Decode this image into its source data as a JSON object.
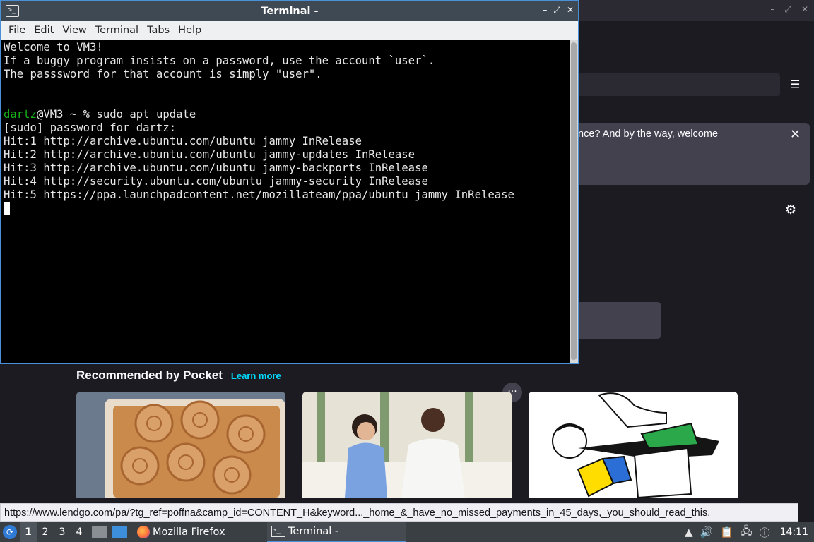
{
  "terminal": {
    "title": "Terminal -",
    "icon": "terminal-icon",
    "menu": [
      "File",
      "Edit",
      "View",
      "Terminal",
      "Tabs",
      "Help"
    ],
    "lines": [
      "Welcome to VM3!",
      "If a buggy program insists on a password, use the account `user`.",
      "The passsword for that account is simply \"user\".",
      "",
      ""
    ],
    "prompt": {
      "user": "dartz",
      "host_path": "@VM3 ~ % ",
      "command": "sudo apt update"
    },
    "output": [
      "[sudo] password for dartz:",
      "Hit:1 http://archive.ubuntu.com/ubuntu jammy InRelease",
      "Hit:2 http://archive.ubuntu.com/ubuntu jammy-updates InRelease",
      "Hit:3 http://archive.ubuntu.com/ubuntu jammy-backports InRelease",
      "Hit:4 http://security.ubuntu.com/ubuntu jammy-security InRelease",
      "Hit:5 https://ppa.launchpadcontent.net/mozillateam/ppa/ubuntu jammy InRelease"
    ]
  },
  "firefox": {
    "notice_text": "nce? And by the way, welcome",
    "menu_icon": "hamburger-menu-icon",
    "pocket_title": "Recommended by Pocket",
    "pocket_learn_more": "Learn more",
    "status_url": "https://www.lendgo.com/pa/?tg_ref=poffna&camp_id=CONTENT_H&keyword..._home_&_have_no_missed_payments_in_45_days,_you_should_read_this."
  },
  "taskbar": {
    "workspaces": [
      "1",
      "2",
      "3",
      "4"
    ],
    "active_workspace": "1",
    "firefox_task": "Mozilla Firefox",
    "terminal_task": "Terminal -",
    "clock": "14:11"
  }
}
